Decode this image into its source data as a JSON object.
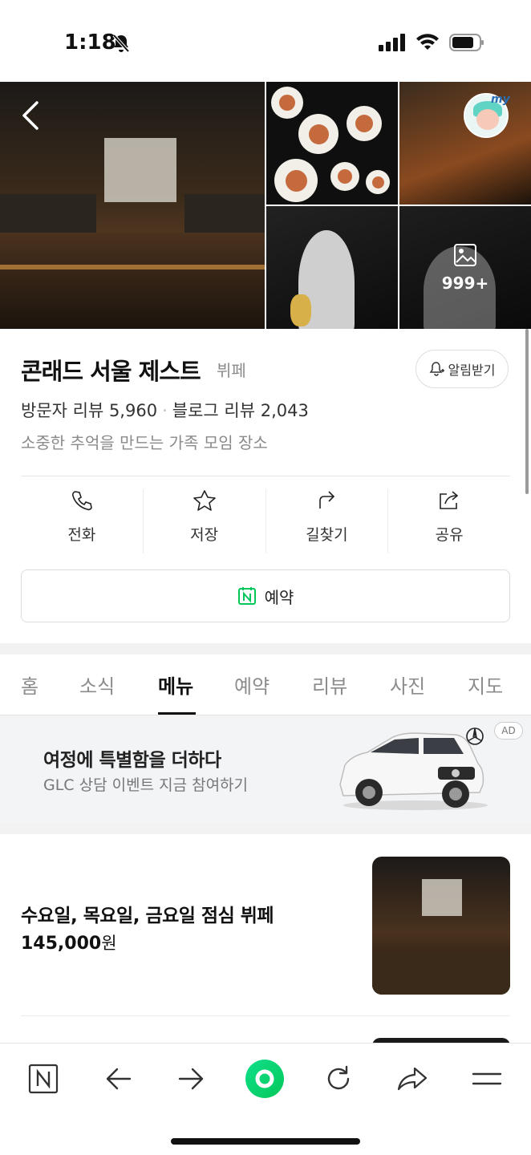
{
  "status_bar": {
    "time": "1:18"
  },
  "hero": {
    "photo_count": "999+"
  },
  "place": {
    "name": "콘래드 서울 제스트",
    "category": "뷔페",
    "alarm_label": "알림받기",
    "visitor_reviews": "방문자 리뷰 5,960",
    "blog_reviews": "블로그 리뷰 2,043",
    "description": "소중한 추억을 만드는 가족 모임 장소"
  },
  "actions": [
    {
      "label": "전화",
      "icon": "phone-icon"
    },
    {
      "label": "저장",
      "icon": "star-icon"
    },
    {
      "label": "길찾기",
      "icon": "directions-icon"
    },
    {
      "label": "공유",
      "icon": "share-icon"
    }
  ],
  "reserve_label": "예약",
  "tabs": [
    {
      "label": "홈"
    },
    {
      "label": "소식"
    },
    {
      "label": "메뉴",
      "active": true
    },
    {
      "label": "예약"
    },
    {
      "label": "리뷰"
    },
    {
      "label": "사진"
    },
    {
      "label": "지도"
    }
  ],
  "ad": {
    "headline": "여정에 특별함을 더하다",
    "sub": "GLC 상담 이벤트 지금 참여하기",
    "badge": "AD"
  },
  "menu_items": [
    {
      "name": "수요일, 목요일, 금요일 점심 뷔페",
      "price": "145,000",
      "unit": "원"
    }
  ],
  "colors": {
    "accent_green": "#03c75a",
    "text": "#111111",
    "muted": "#8a8a8a"
  }
}
